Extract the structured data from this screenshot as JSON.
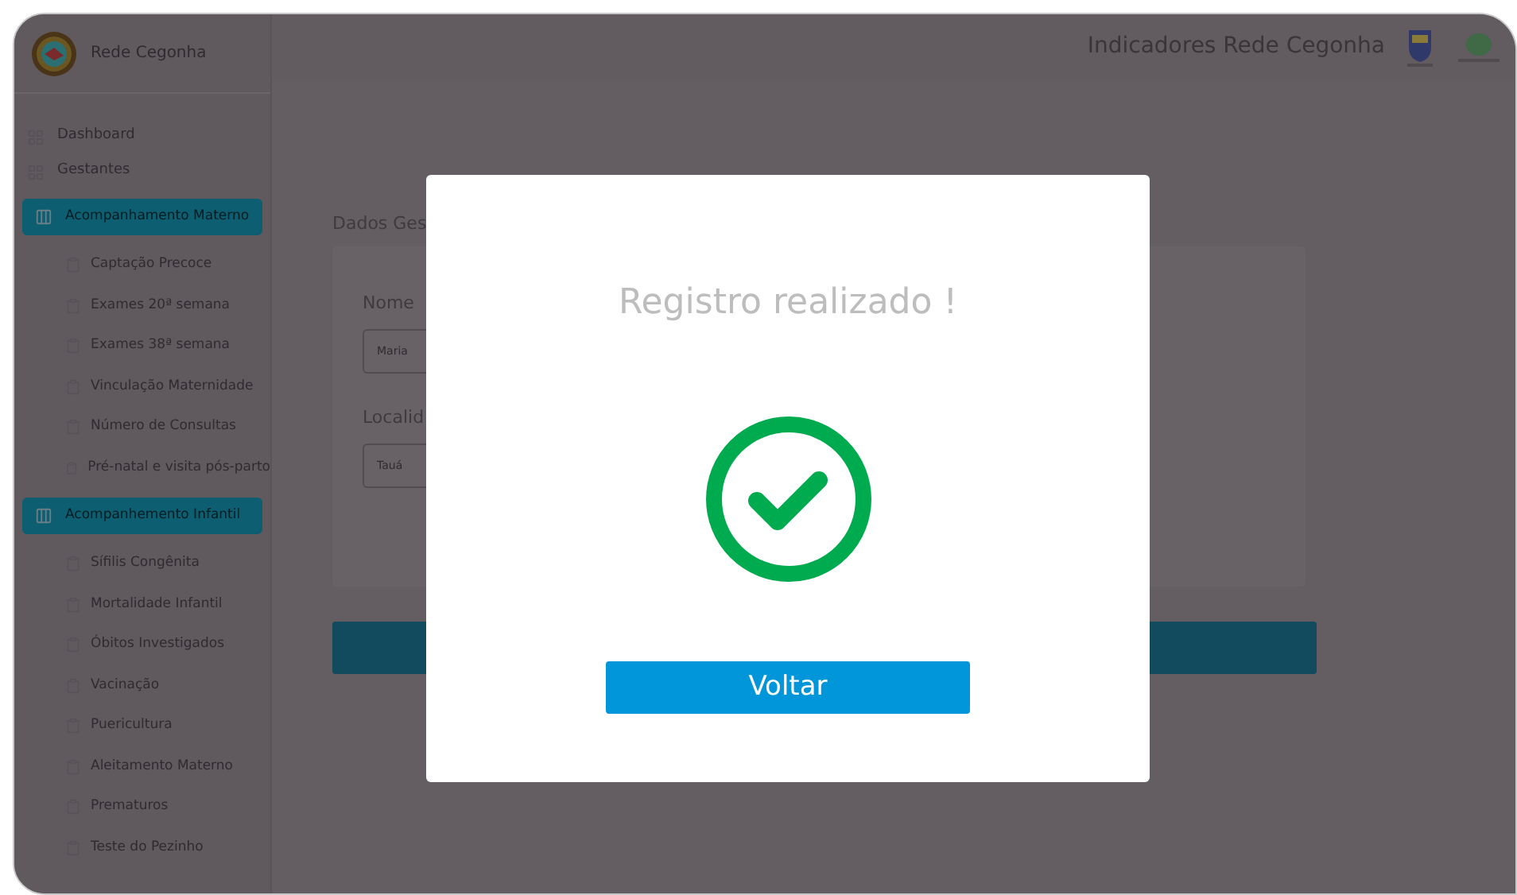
{
  "header": {
    "brand": "Rede Cegonha",
    "title": "Indicadores Rede Cegonha"
  },
  "sidebar": {
    "items": [
      {
        "kind": "link",
        "label": "Dashboard"
      },
      {
        "kind": "link",
        "label": "Gestantes"
      },
      {
        "kind": "section",
        "label": "Acompanhamento Materno",
        "children": [
          {
            "label": "Captação Precoce"
          },
          {
            "label": "Exames 20ª semana"
          },
          {
            "label": "Exames 38ª semana"
          },
          {
            "label": "Vinculação Maternidade"
          },
          {
            "label": "Número de Consultas"
          },
          {
            "label": "Pré-natal e visita pós-parto"
          }
        ]
      },
      {
        "kind": "section",
        "label": "Acompanhemento Infantil",
        "children": [
          {
            "label": "Sífilis Congênita"
          },
          {
            "label": "Mortalidade Infantil"
          },
          {
            "label": "Óbitos Investigados"
          },
          {
            "label": "Vacinação"
          },
          {
            "label": "Puericultura"
          },
          {
            "label": "Aleitamento Materno"
          },
          {
            "label": "Prematuros"
          },
          {
            "label": "Teste do Pezinho"
          }
        ]
      }
    ]
  },
  "form": {
    "heading": "Dados Ges",
    "fields": [
      {
        "label": "Nome",
        "value": "Maria"
      },
      {
        "label": "Localid",
        "value": "Tauá"
      }
    ]
  },
  "dialog": {
    "title": "Registro realizado !",
    "button": "Voltar"
  }
}
